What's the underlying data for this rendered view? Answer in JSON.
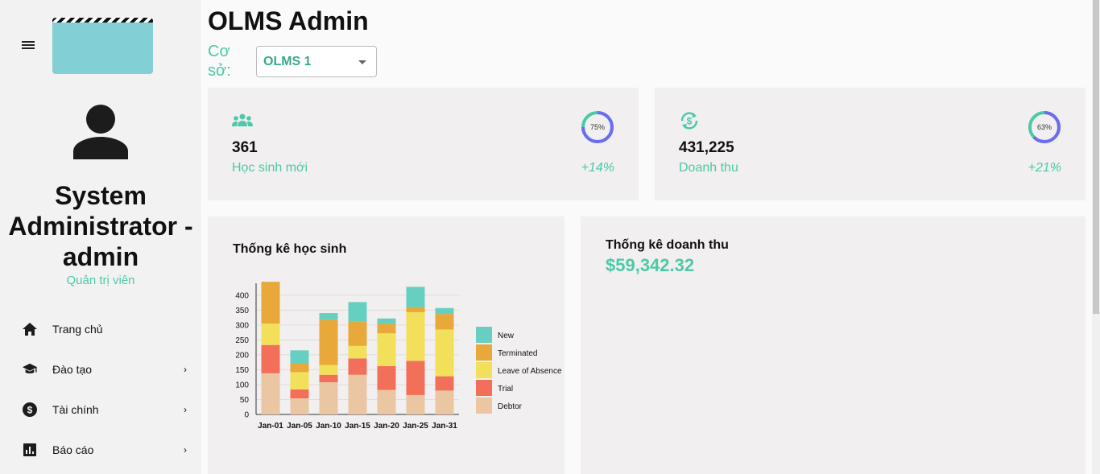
{
  "sidebar": {
    "user_name": "System Administrator - admin",
    "user_role": "Quản trị viên",
    "items": [
      {
        "label": "Trang chủ",
        "icon": "home-icon",
        "has_submenu": false
      },
      {
        "label": "Đào tạo",
        "icon": "graduation-cap-icon",
        "has_submenu": true
      },
      {
        "label": "Tài chính",
        "icon": "dollar-circle-icon",
        "has_submenu": true
      },
      {
        "label": "Báo cáo",
        "icon": "bar-chart-icon",
        "has_submenu": true
      }
    ]
  },
  "header": {
    "title": "OLMS Admin",
    "branch_label": "Cơ sở:",
    "branch_value": "OLMS 1"
  },
  "stats": [
    {
      "value": "361",
      "label": "Học sinh mới",
      "change": "+14%",
      "ring_text": "75%",
      "ring_percent": 75,
      "icon": "group-icon"
    },
    {
      "value": "431,225",
      "label": "Doanh thu",
      "change": "+21%",
      "ring_text": "63%",
      "ring_percent": 63,
      "icon": "currency-exchange-icon"
    }
  ],
  "student_chart": {
    "title": "Thống kê học sinh"
  },
  "revenue": {
    "title": "Thống kê doanh thu",
    "value": "$59,342.32"
  },
  "colors": {
    "accent": "#4cc9a8",
    "card_bg": "#f1efef",
    "ring_blue": "#6c6cf0"
  },
  "chart_data": {
    "type": "bar",
    "stacked": true,
    "categories": [
      "Jan-01",
      "Jan-05",
      "Jan-10",
      "Jan-15",
      "Jan-20",
      "Jan-25",
      "Jan-31"
    ],
    "series": [
      {
        "name": "Debtor",
        "color": "#ebc6a3",
        "values": [
          138,
          54,
          108,
          133,
          82,
          65,
          80
        ]
      },
      {
        "name": "Trial",
        "color": "#f2705a",
        "values": [
          95,
          30,
          25,
          55,
          80,
          115,
          48
        ]
      },
      {
        "name": "Leave of Absence",
        "color": "#f2df5a",
        "values": [
          72,
          58,
          33,
          42,
          110,
          163,
          157
        ]
      },
      {
        "name": "Terminated",
        "color": "#e8a83a",
        "values": [
          140,
          28,
          152,
          82,
          32,
          17,
          52
        ]
      },
      {
        "name": "New",
        "color": "#66cfc0",
        "values": [
          0,
          45,
          22,
          65,
          18,
          68,
          20
        ]
      }
    ],
    "legend_order": [
      "New",
      "Terminated",
      "Leave of Absence",
      "Trial",
      "Debtor"
    ],
    "y_ticks": [
      0,
      50,
      100,
      150,
      200,
      250,
      300,
      350,
      400
    ],
    "ylim": [
      0,
      440
    ],
    "grid": true,
    "legend_position": "right"
  }
}
